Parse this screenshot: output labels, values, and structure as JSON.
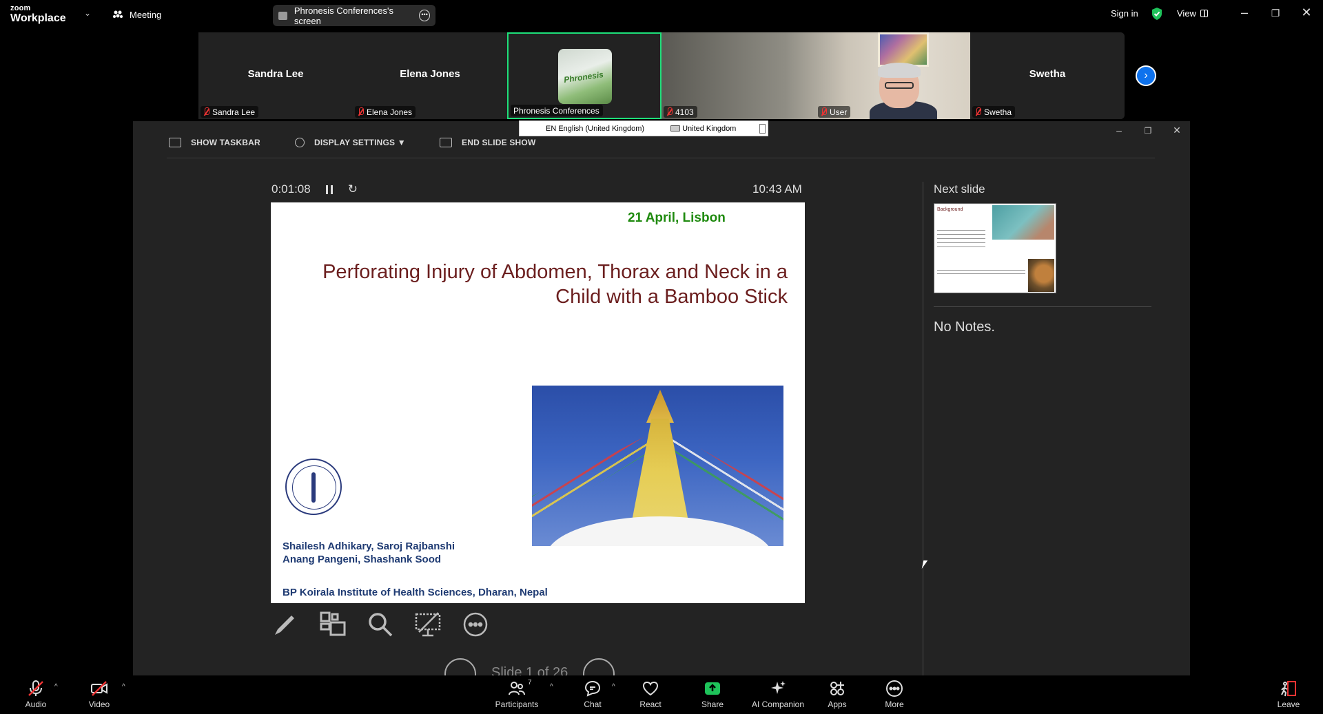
{
  "topbar": {
    "logo_line1": "zoom",
    "logo_line2": "Workplace",
    "meeting_label": "Meeting",
    "screen_share_label": "Phronesis Conferences's screen",
    "signin_label": "Sign in",
    "view_label": "View"
  },
  "participants_strip": [
    {
      "name": "Sandra Lee",
      "label": "Sandra Lee",
      "muted": true
    },
    {
      "name": "Elena Jones",
      "label": "Elena Jones",
      "muted": true
    },
    {
      "name": "",
      "label": "Phronesis Conferences",
      "muted": false,
      "active": true,
      "logo_text": "Phronesis"
    },
    {
      "name": "",
      "label": "4103",
      "muted": true
    },
    {
      "name": "",
      "label": "User",
      "muted": true
    },
    {
      "name": "Swetha",
      "label": "Swetha",
      "muted": true
    }
  ],
  "language_bar": {
    "input_language": "EN English (United Kingdom)",
    "keyboard": "United Kingdom"
  },
  "presenter": {
    "toolbar": {
      "show_taskbar": "SHOW TASKBAR",
      "display_settings": "DISPLAY SETTINGS ▼",
      "end_slide_show": "END SLIDE SHOW"
    },
    "timer": "0:01:08",
    "clock": "10:43 AM",
    "slide": {
      "date": "21 April, Lisbon",
      "title_line1": "Perforating Injury of Abdomen, Thorax and Neck in a",
      "title_line2": "Child with a Bamboo Stick",
      "authors_line1": "Shailesh Adhikary, Saroj Rajbanshi",
      "authors_line2": "Anang Pangeni, Shashank Sood",
      "institution": "BP Koirala Institute of Health Sciences, Dharan, Nepal"
    },
    "slide_counter": "Slide 1 of 26",
    "next_slide_label": "Next slide",
    "next_slide_heading": "Background",
    "notes": "No Notes."
  },
  "bottombar": {
    "audio": "Audio",
    "video": "Video",
    "participants": "Participants",
    "participants_count": "7",
    "chat": "Chat",
    "react": "React",
    "share": "Share",
    "ai_companion": "AI Companion",
    "apps": "Apps",
    "more": "More",
    "leave": "Leave"
  },
  "colors": {
    "share_green": "#1ee07a",
    "accent_blue": "#0e72ed",
    "muted_red": "#e33333",
    "slide_title": "#6b1e1e",
    "slide_date": "#1f8a0f",
    "slide_authors": "#1f3b73"
  }
}
